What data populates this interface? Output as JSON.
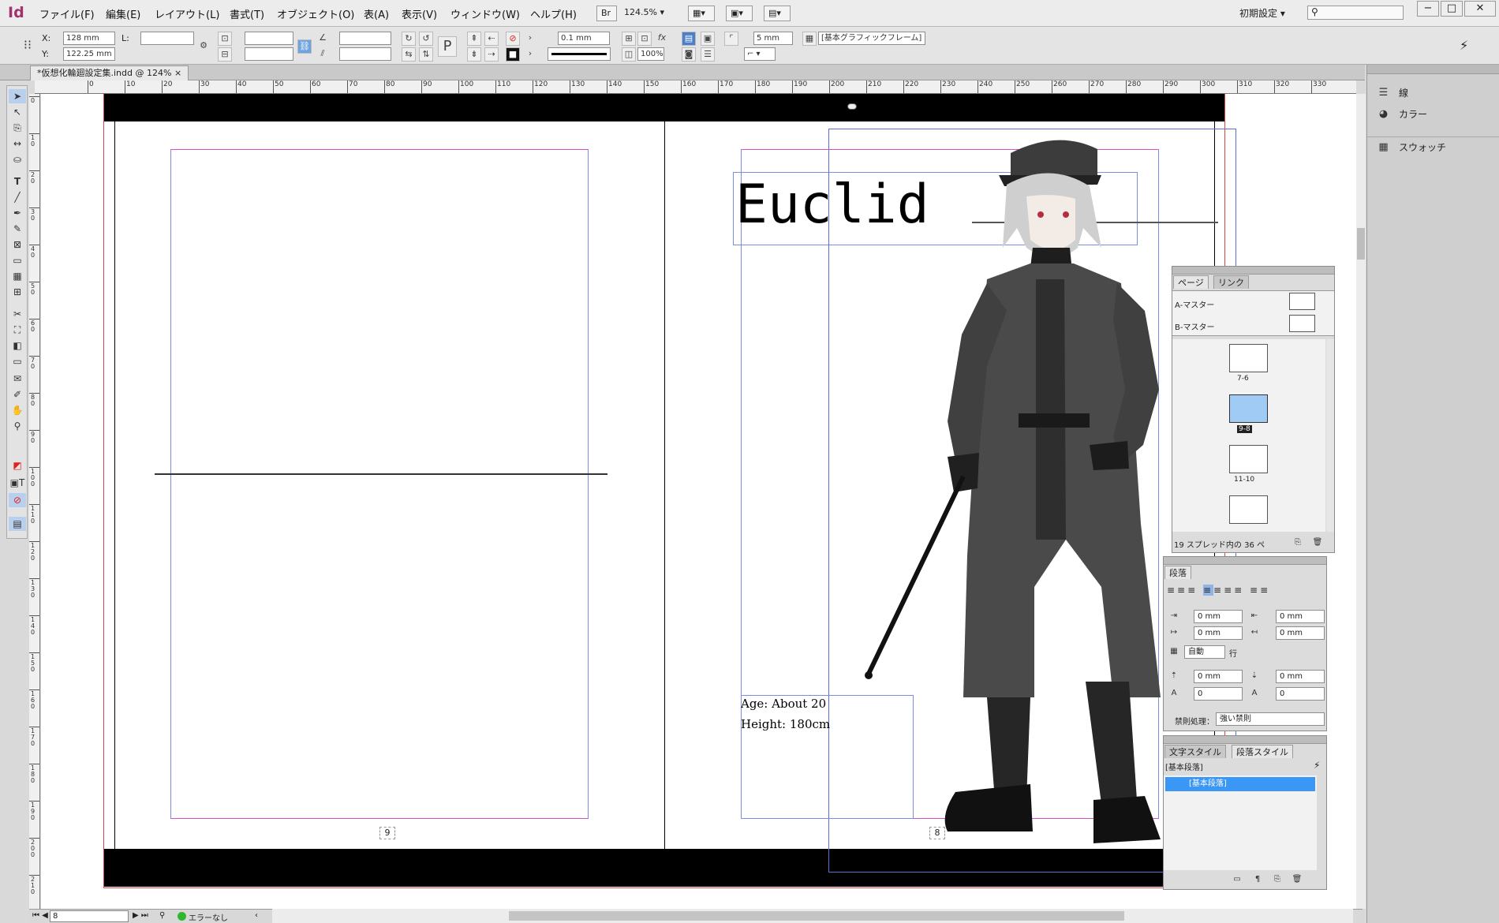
{
  "app": {
    "logo": "Id"
  },
  "menu": [
    "ファイル(F)",
    "編集(E)",
    "レイアウト(L)",
    "書式(T)",
    "オブジェクト(O)",
    "表(A)",
    "表示(V)",
    "ウィンドウ(W)",
    "ヘルプ(H)"
  ],
  "menubar_right": {
    "bridge": "Br",
    "zoom": "124.5%",
    "workspace": "初期設定",
    "window_min": "▭",
    "window_max": "□",
    "window_close": "✕"
  },
  "control": {
    "x_label": "X:",
    "x_value": "128 mm",
    "y_label": "Y:",
    "y_value": "122.25 mm",
    "l_label": "L:",
    "stroke_weight": "0.1 mm",
    "scale": "100%",
    "offset": "5 mm",
    "object_style": "[基本グラフィックフレーム]"
  },
  "document_tab": {
    "title": "*仮想化輪廻設定集.indd @ 124%",
    "close": "×"
  },
  "ruler": {
    "top": [
      "0",
      "10",
      "20",
      "30",
      "40",
      "50",
      "60",
      "70",
      "80",
      "90",
      "100",
      "110",
      "120",
      "130",
      "140",
      "150",
      "160",
      "170",
      "180",
      "190",
      "200",
      "210",
      "220",
      "230",
      "240",
      "250",
      "260",
      "270",
      "280",
      "290",
      "300",
      "310",
      "320",
      "330"
    ],
    "left": [
      "0",
      "10",
      "20",
      "30",
      "40",
      "50",
      "60",
      "70",
      "80",
      "90",
      "100",
      "110",
      "120",
      "130",
      "140",
      "150",
      "160",
      "170",
      "180",
      "190",
      "200",
      "210"
    ]
  },
  "spread": {
    "title": "Euclid",
    "info_lines": [
      "Age: About 20",
      "Height: 180cm"
    ],
    "page_left": "9",
    "page_right": "8"
  },
  "dock": {
    "items": [
      "線",
      "カラー",
      "スウォッチ"
    ]
  },
  "pages_panel": {
    "tabs": [
      "ページ",
      "リンク"
    ],
    "masters": [
      "A-マスター",
      "B-マスター"
    ],
    "spreads": [
      "7-6",
      "9-8",
      "11-10"
    ],
    "footer": "19 スプレッド内の 36 ペ"
  },
  "paragraph_panel": {
    "title": "段落",
    "fields": [
      "0 mm",
      "0 mm",
      "0 mm",
      "0 mm",
      "0 mm",
      "0 mm",
      "0",
      "0"
    ],
    "leading": "自動",
    "leading_unit": "行",
    "kinsoku_label": "禁則処理：",
    "kinsoku_value": "強い禁則"
  },
  "styles_panel": {
    "tabs": [
      "文字スタイル",
      "段落スタイル"
    ],
    "current": "[基本段落]",
    "items": [
      "[基本段落]"
    ]
  },
  "statusbar": {
    "page": "8",
    "preflight": "エラーなし"
  },
  "colors": {
    "accent_blue": "#3a97f6",
    "margin_magenta": "#d84fc3",
    "bleed_red": "#e0424a",
    "frame_blue": "#7b8fdd",
    "logo": "#a0336b"
  },
  "icons": [
    "selection-tool-icon",
    "direct-selection-icon",
    "type-tool-icon",
    "pen-tool-icon",
    "rectangle-frame-icon",
    "scissors-icon",
    "gradient-icon",
    "eyedropper-icon",
    "hand-tool-icon",
    "zoom-tool-icon",
    "lightning-icon",
    "search-icon"
  ]
}
